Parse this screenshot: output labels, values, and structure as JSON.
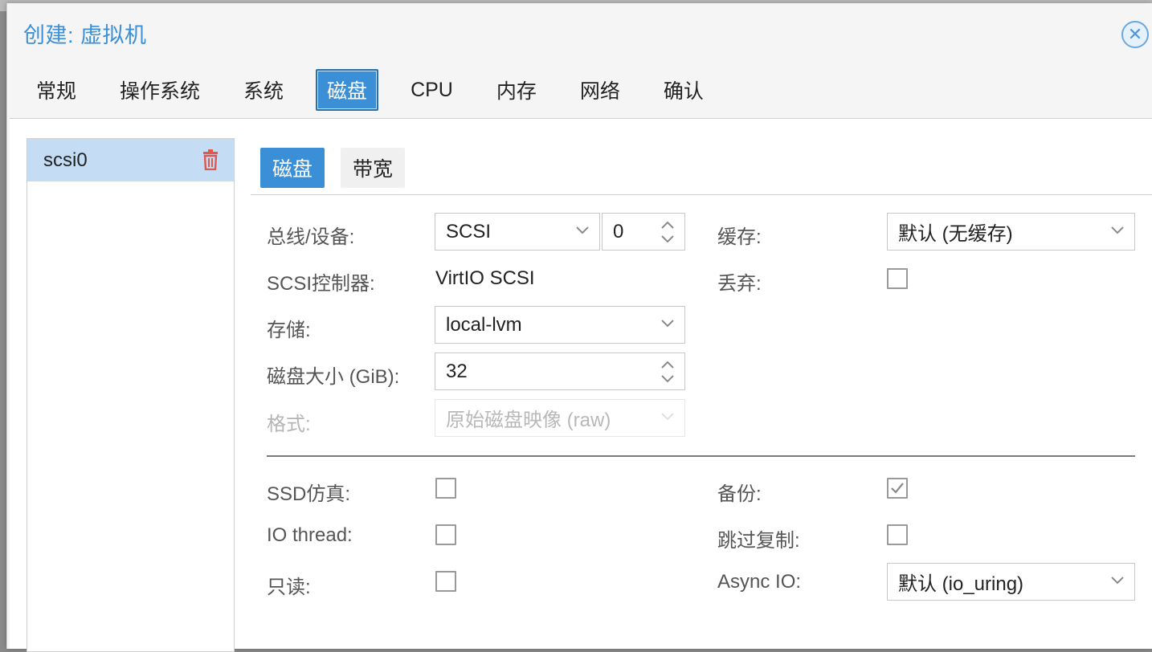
{
  "dialog": {
    "title": "创建: 虚拟机",
    "close_icon": "close-circle-icon"
  },
  "tabs": [
    {
      "label": "常规",
      "active": false
    },
    {
      "label": "操作系统",
      "active": false
    },
    {
      "label": "系统",
      "active": false
    },
    {
      "label": "磁盘",
      "active": true
    },
    {
      "label": "CPU",
      "active": false
    },
    {
      "label": "内存",
      "active": false
    },
    {
      "label": "网络",
      "active": false
    },
    {
      "label": "确认",
      "active": false
    }
  ],
  "device_list": {
    "items": [
      {
        "label": "scsi0",
        "selected": true,
        "remove_icon": "trash-icon"
      }
    ]
  },
  "subtabs": [
    {
      "label": "磁盘",
      "active": true
    },
    {
      "label": "带宽",
      "active": false
    }
  ],
  "form": {
    "bus_device": {
      "label": "总线/设备:",
      "bus": "SCSI",
      "device": "0"
    },
    "scsi_controller": {
      "label": "SCSI控制器:",
      "value": "VirtIO SCSI"
    },
    "storage": {
      "label": "存储:",
      "value": "local-lvm"
    },
    "disk_size": {
      "label": "磁盘大小 (GiB):",
      "value": "32"
    },
    "format": {
      "label": "格式:",
      "value": "原始磁盘映像 (raw)",
      "disabled": true
    },
    "cache": {
      "label": "缓存:",
      "value": "默认 (无缓存)"
    },
    "discard": {
      "label": "丢弃:",
      "checked": false
    },
    "ssd_emulation": {
      "label": "SSD仿真:",
      "checked": false
    },
    "io_thread": {
      "label": "IO thread:",
      "checked": false
    },
    "read_only": {
      "label": "只读:",
      "checked": false
    },
    "backup": {
      "label": "备份:",
      "checked": true
    },
    "skip_replication": {
      "label": "跳过复制:",
      "checked": false
    },
    "async_io": {
      "label": "Async IO:",
      "value": "默认 (io_uring)"
    }
  },
  "colors": {
    "accent": "#3a8fd6",
    "selected_row": "#c4ddf4",
    "trash": "#e2564b"
  }
}
